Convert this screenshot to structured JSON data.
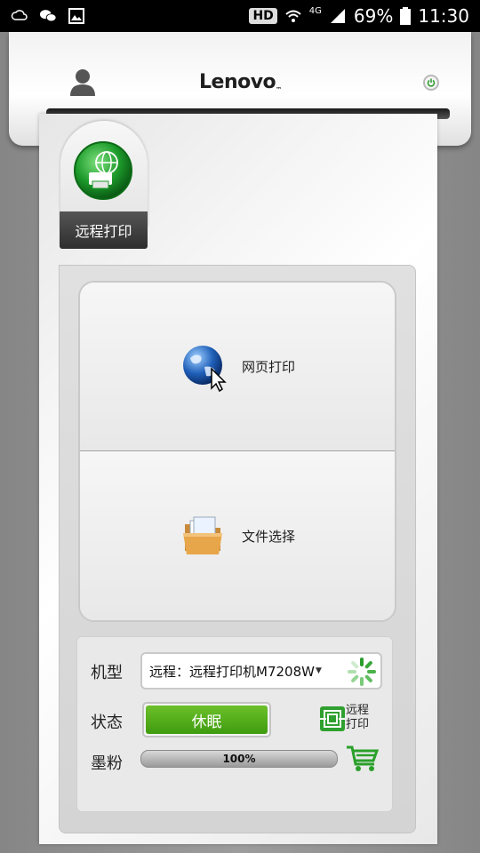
{
  "status_bar": {
    "hd": "HD",
    "network": "4G",
    "battery": "69%",
    "time": "11:30"
  },
  "header": {
    "brand": "Lenovo",
    "brand_mark": "™"
  },
  "tab": {
    "label": "远程打印",
    "icon": "globe-printer-icon"
  },
  "actions": {
    "web_print": {
      "label": "网页打印",
      "icon": "globe-cursor-icon"
    },
    "file_select": {
      "label": "文件选择",
      "icon": "folder-icon"
    }
  },
  "info": {
    "model_label": "机型",
    "model_value": "远程：远程打印机M7208W",
    "status_label": "状态",
    "status_value": "休眠",
    "remote_print_label_line1": "远程",
    "remote_print_label_line2": "打印",
    "toner_label": "墨粉",
    "toner_value": "100%",
    "toner_level": 1.0
  },
  "colors": {
    "status_green": "#4fa81b",
    "accent_green": "#2a9a2a"
  }
}
